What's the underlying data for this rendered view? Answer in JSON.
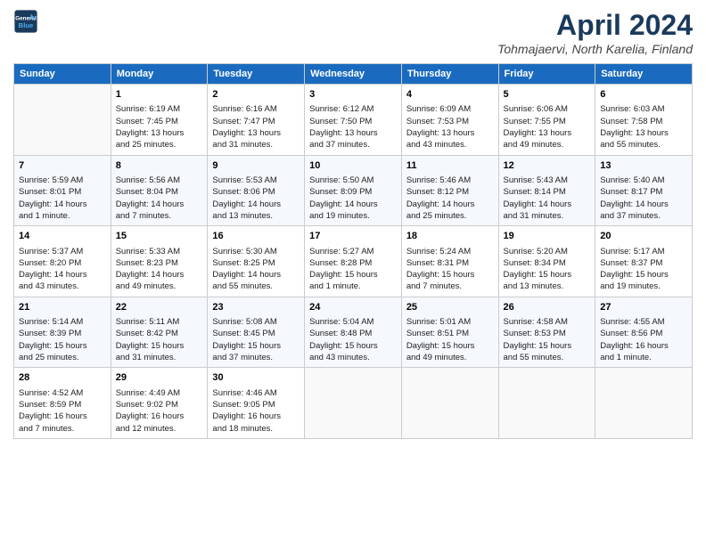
{
  "header": {
    "logo_line1": "General",
    "logo_line2": "Blue",
    "month": "April 2024",
    "location": "Tohmajaervi, North Karelia, Finland"
  },
  "days_of_week": [
    "Sunday",
    "Monday",
    "Tuesday",
    "Wednesday",
    "Thursday",
    "Friday",
    "Saturday"
  ],
  "weeks": [
    [
      {
        "day": "",
        "content": ""
      },
      {
        "day": "1",
        "content": "Sunrise: 6:19 AM\nSunset: 7:45 PM\nDaylight: 13 hours\nand 25 minutes."
      },
      {
        "day": "2",
        "content": "Sunrise: 6:16 AM\nSunset: 7:47 PM\nDaylight: 13 hours\nand 31 minutes."
      },
      {
        "day": "3",
        "content": "Sunrise: 6:12 AM\nSunset: 7:50 PM\nDaylight: 13 hours\nand 37 minutes."
      },
      {
        "day": "4",
        "content": "Sunrise: 6:09 AM\nSunset: 7:53 PM\nDaylight: 13 hours\nand 43 minutes."
      },
      {
        "day": "5",
        "content": "Sunrise: 6:06 AM\nSunset: 7:55 PM\nDaylight: 13 hours\nand 49 minutes."
      },
      {
        "day": "6",
        "content": "Sunrise: 6:03 AM\nSunset: 7:58 PM\nDaylight: 13 hours\nand 55 minutes."
      }
    ],
    [
      {
        "day": "7",
        "content": "Sunrise: 5:59 AM\nSunset: 8:01 PM\nDaylight: 14 hours\nand 1 minute."
      },
      {
        "day": "8",
        "content": "Sunrise: 5:56 AM\nSunset: 8:04 PM\nDaylight: 14 hours\nand 7 minutes."
      },
      {
        "day": "9",
        "content": "Sunrise: 5:53 AM\nSunset: 8:06 PM\nDaylight: 14 hours\nand 13 minutes."
      },
      {
        "day": "10",
        "content": "Sunrise: 5:50 AM\nSunset: 8:09 PM\nDaylight: 14 hours\nand 19 minutes."
      },
      {
        "day": "11",
        "content": "Sunrise: 5:46 AM\nSunset: 8:12 PM\nDaylight: 14 hours\nand 25 minutes."
      },
      {
        "day": "12",
        "content": "Sunrise: 5:43 AM\nSunset: 8:14 PM\nDaylight: 14 hours\nand 31 minutes."
      },
      {
        "day": "13",
        "content": "Sunrise: 5:40 AM\nSunset: 8:17 PM\nDaylight: 14 hours\nand 37 minutes."
      }
    ],
    [
      {
        "day": "14",
        "content": "Sunrise: 5:37 AM\nSunset: 8:20 PM\nDaylight: 14 hours\nand 43 minutes."
      },
      {
        "day": "15",
        "content": "Sunrise: 5:33 AM\nSunset: 8:23 PM\nDaylight: 14 hours\nand 49 minutes."
      },
      {
        "day": "16",
        "content": "Sunrise: 5:30 AM\nSunset: 8:25 PM\nDaylight: 14 hours\nand 55 minutes."
      },
      {
        "day": "17",
        "content": "Sunrise: 5:27 AM\nSunset: 8:28 PM\nDaylight: 15 hours\nand 1 minute."
      },
      {
        "day": "18",
        "content": "Sunrise: 5:24 AM\nSunset: 8:31 PM\nDaylight: 15 hours\nand 7 minutes."
      },
      {
        "day": "19",
        "content": "Sunrise: 5:20 AM\nSunset: 8:34 PM\nDaylight: 15 hours\nand 13 minutes."
      },
      {
        "day": "20",
        "content": "Sunrise: 5:17 AM\nSunset: 8:37 PM\nDaylight: 15 hours\nand 19 minutes."
      }
    ],
    [
      {
        "day": "21",
        "content": "Sunrise: 5:14 AM\nSunset: 8:39 PM\nDaylight: 15 hours\nand 25 minutes."
      },
      {
        "day": "22",
        "content": "Sunrise: 5:11 AM\nSunset: 8:42 PM\nDaylight: 15 hours\nand 31 minutes."
      },
      {
        "day": "23",
        "content": "Sunrise: 5:08 AM\nSunset: 8:45 PM\nDaylight: 15 hours\nand 37 minutes."
      },
      {
        "day": "24",
        "content": "Sunrise: 5:04 AM\nSunset: 8:48 PM\nDaylight: 15 hours\nand 43 minutes."
      },
      {
        "day": "25",
        "content": "Sunrise: 5:01 AM\nSunset: 8:51 PM\nDaylight: 15 hours\nand 49 minutes."
      },
      {
        "day": "26",
        "content": "Sunrise: 4:58 AM\nSunset: 8:53 PM\nDaylight: 15 hours\nand 55 minutes."
      },
      {
        "day": "27",
        "content": "Sunrise: 4:55 AM\nSunset: 8:56 PM\nDaylight: 16 hours\nand 1 minute."
      }
    ],
    [
      {
        "day": "28",
        "content": "Sunrise: 4:52 AM\nSunset: 8:59 PM\nDaylight: 16 hours\nand 7 minutes."
      },
      {
        "day": "29",
        "content": "Sunrise: 4:49 AM\nSunset: 9:02 PM\nDaylight: 16 hours\nand 12 minutes."
      },
      {
        "day": "30",
        "content": "Sunrise: 4:46 AM\nSunset: 9:05 PM\nDaylight: 16 hours\nand 18 minutes."
      },
      {
        "day": "",
        "content": ""
      },
      {
        "day": "",
        "content": ""
      },
      {
        "day": "",
        "content": ""
      },
      {
        "day": "",
        "content": ""
      }
    ]
  ]
}
